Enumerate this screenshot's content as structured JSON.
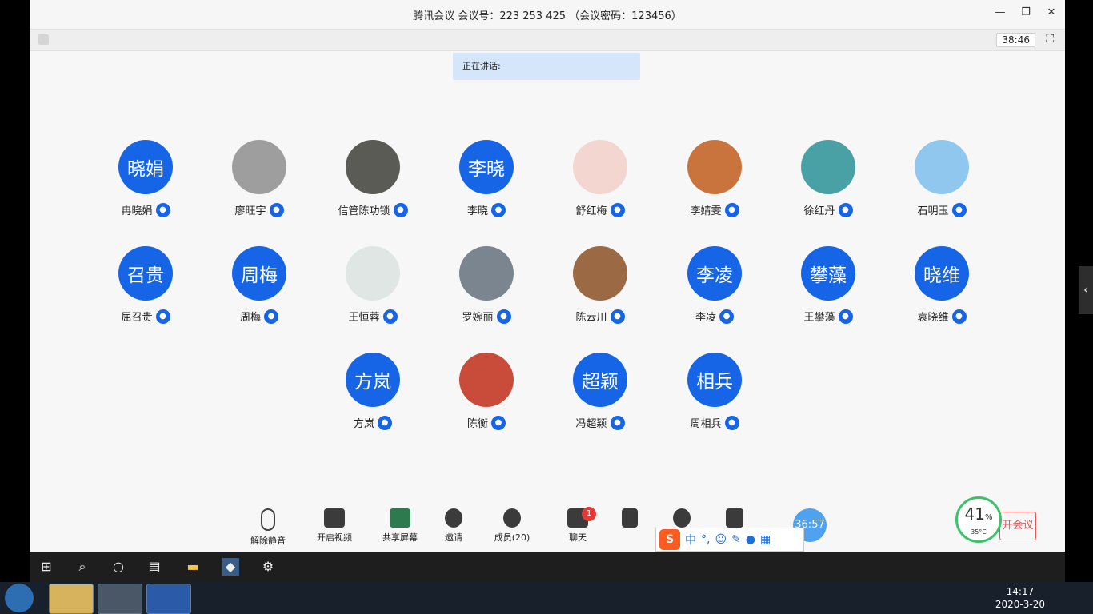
{
  "window": {
    "title": "腾讯会议 会议号：223 253 425 （会议密码：123456）",
    "controls": [
      "—",
      "❐",
      "✕"
    ],
    "elapsed": "38:46",
    "speaking_label": "正在讲话:"
  },
  "participants": [
    {
      "name": "冉晓娟",
      "avatar_text": "晓娟",
      "kind": "text"
    },
    {
      "name": "廖旺宇",
      "avatar_text": "",
      "kind": "image",
      "color": "#9e9e9e"
    },
    {
      "name": "信管陈功锁",
      "avatar_text": "",
      "kind": "image",
      "color": "#5b5b55"
    },
    {
      "name": "李晓",
      "avatar_text": "李晓",
      "kind": "text"
    },
    {
      "name": "舒红梅",
      "avatar_text": "",
      "kind": "image",
      "color": "#f3d6d0"
    },
    {
      "name": "李婧雯",
      "avatar_text": "",
      "kind": "image",
      "color": "#c9743d"
    },
    {
      "name": "徐红丹",
      "avatar_text": "",
      "kind": "image",
      "color": "#4aa1a5"
    },
    {
      "name": "石明玉",
      "avatar_text": "",
      "kind": "image",
      "color": "#8fc7ee"
    },
    {
      "name": "屈召贵",
      "avatar_text": "召贵",
      "kind": "text"
    },
    {
      "name": "周梅",
      "avatar_text": "周梅",
      "kind": "text"
    },
    {
      "name": "王恒蓉",
      "avatar_text": "",
      "kind": "image",
      "color": "#e0e6e3"
    },
    {
      "name": "罗婉丽",
      "avatar_text": "",
      "kind": "image",
      "color": "#7a858f"
    },
    {
      "name": "陈云川",
      "avatar_text": "",
      "kind": "image",
      "color": "#9b6a45"
    },
    {
      "name": "李凌",
      "avatar_text": "李凌",
      "kind": "text"
    },
    {
      "name": "王攀藻",
      "avatar_text": "攀藻",
      "kind": "text"
    },
    {
      "name": "袁晓维",
      "avatar_text": "晓维",
      "kind": "text"
    },
    {
      "name": "方岚",
      "avatar_text": "方岚",
      "kind": "text"
    },
    {
      "name": "陈衡",
      "avatar_text": "",
      "kind": "image",
      "color": "#c94c3a"
    },
    {
      "name": "冯超颖",
      "avatar_text": "超颖",
      "kind": "text"
    },
    {
      "name": "周相兵",
      "avatar_text": "相兵",
      "kind": "text"
    }
  ],
  "toolbar": {
    "unmute": "解除静音",
    "video": "开启视频",
    "share": "共享屏幕",
    "invite": "邀请",
    "members": "成员(20)",
    "chat": "聊天",
    "chat_badge": "1",
    "meeting_time": "36:57",
    "end": "开会议"
  },
  "gauge": {
    "percent": "41",
    "unit": "%",
    "temp": "35°C"
  },
  "ime": {
    "logo": "S",
    "mode": "中",
    "punct": "°,"
  },
  "taskbar": {
    "time": "14:17",
    "date": "2020-3-20"
  }
}
